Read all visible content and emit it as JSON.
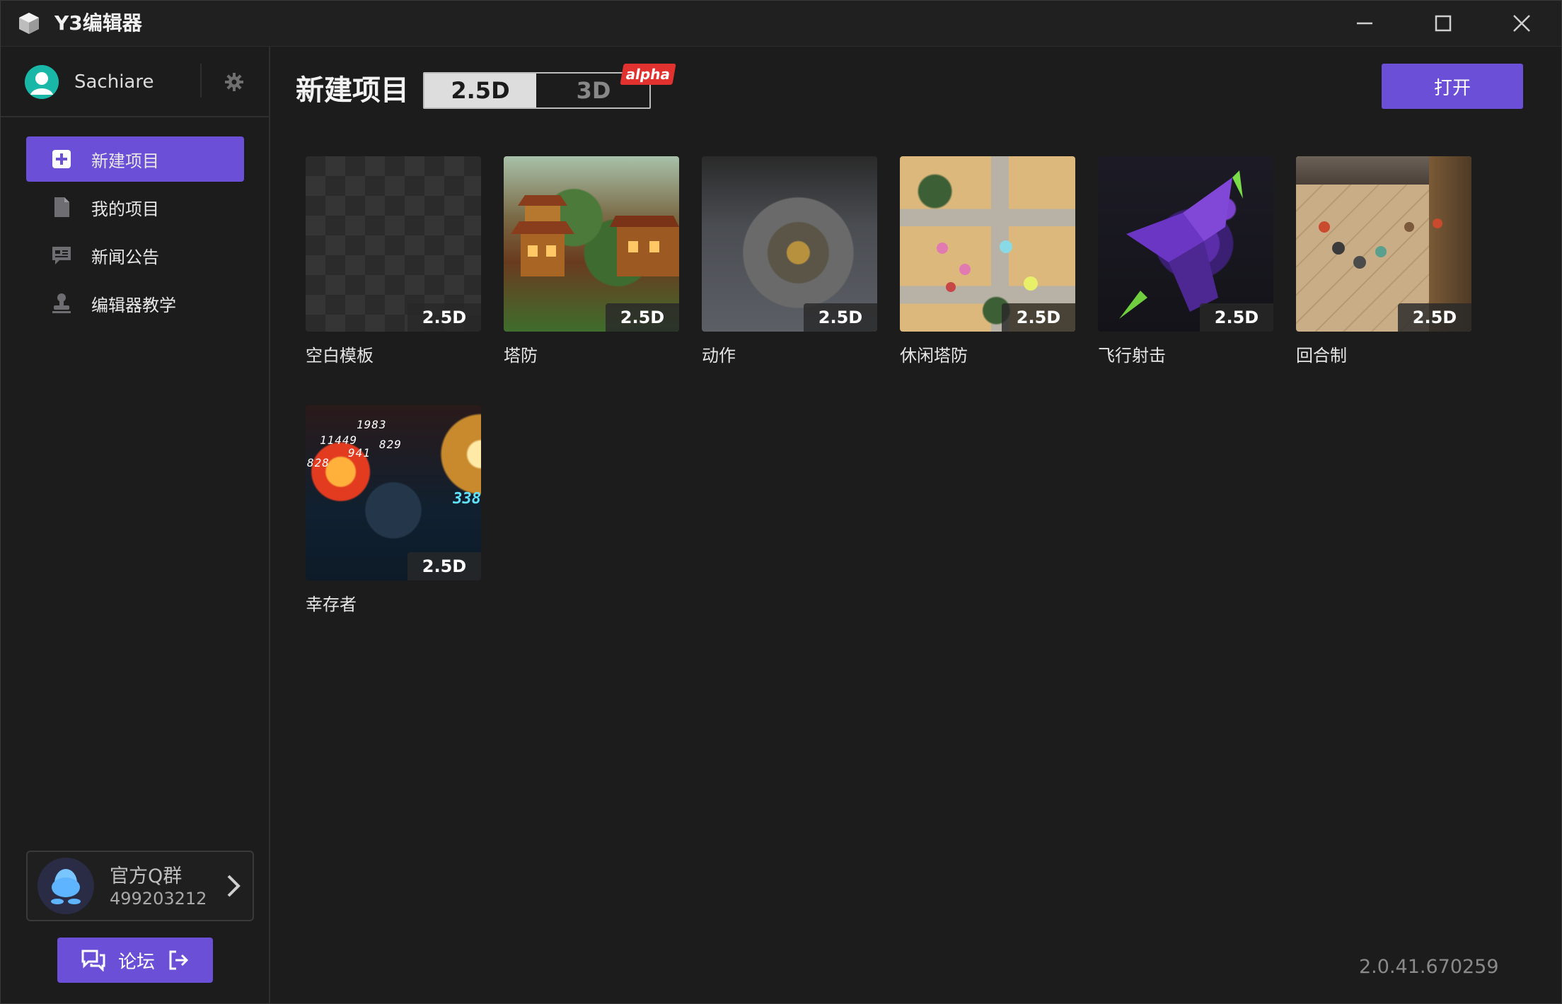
{
  "app": {
    "title": "Y3编辑器"
  },
  "window_controls": {
    "minimize": "minimize-icon",
    "maximize": "maximize-icon",
    "close": "close-icon"
  },
  "sidebar": {
    "user": {
      "name": "Sachiare"
    },
    "nav": [
      {
        "label": "新建项目",
        "icon": "plus-square-icon",
        "active": true
      },
      {
        "label": "我的项目",
        "icon": "document-icon",
        "active": false
      },
      {
        "label": "新闻公告",
        "icon": "news-chat-icon",
        "active": false
      },
      {
        "label": "编辑器教学",
        "icon": "stamp-tutorial-icon",
        "active": false
      }
    ],
    "qq_group": {
      "title": "官方Q群",
      "number": "499203212"
    },
    "forum": {
      "label": "论坛"
    }
  },
  "main": {
    "title": "新建项目",
    "mode_options": [
      "2.5D",
      "3D"
    ],
    "mode_selected": "2.5D",
    "alpha_badge": "alpha",
    "open_button": "打开",
    "templates": [
      {
        "name": "空白模板",
        "badge": "2.5D"
      },
      {
        "name": "塔防",
        "badge": "2.5D"
      },
      {
        "name": "动作",
        "badge": "2.5D"
      },
      {
        "name": "休闲塔防",
        "badge": "2.5D"
      },
      {
        "name": "飞行射击",
        "badge": "2.5D"
      },
      {
        "name": "回合制",
        "badge": "2.5D"
      },
      {
        "name": "幸存者",
        "badge": "2.5D"
      }
    ],
    "version": "2.0.41.670259"
  },
  "colors": {
    "accent": "#6b4fd6",
    "background": "#1c1c1c",
    "alpha_red": "#e2322f",
    "avatar_teal": "#19b7a7"
  }
}
